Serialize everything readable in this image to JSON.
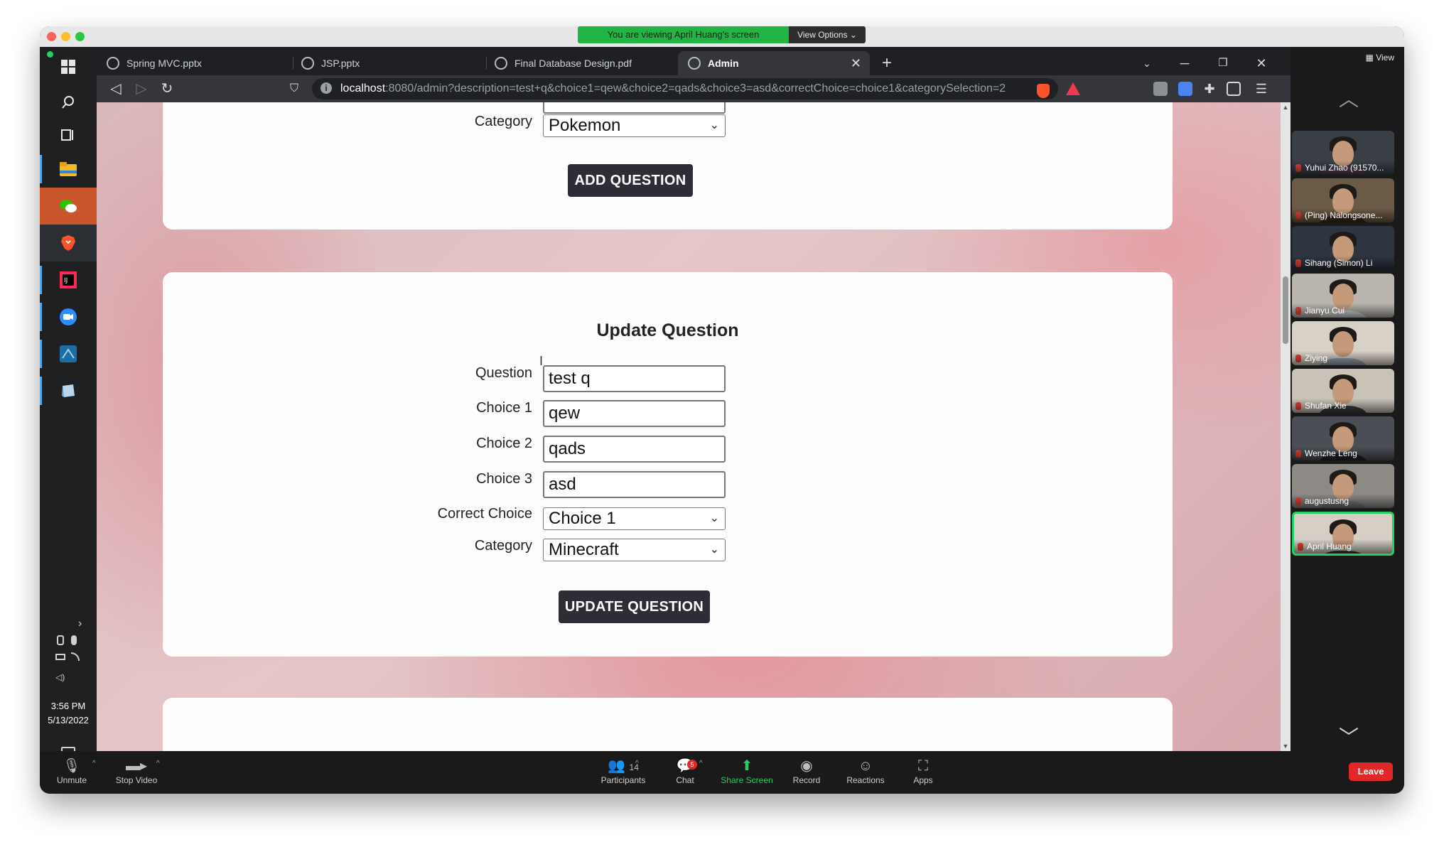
{
  "zoom": {
    "banner_text": "You are viewing April Huang's screen",
    "view_options": "View Options ⌄",
    "panel_view": "View",
    "controls": {
      "unmute": "Unmute",
      "stop_video": "Stop Video",
      "participants": "Participants",
      "participants_count": "14",
      "chat": "Chat",
      "chat_badge": "5",
      "share_screen": "Share Screen",
      "record": "Record",
      "reactions": "Reactions",
      "apps": "Apps",
      "leave": "Leave"
    },
    "participants": [
      {
        "name": "Yuhui Zhao (91570...",
        "shirt": "#5a3d52"
      },
      {
        "name": "(Ping) Nalongsone...",
        "shirt": "#3a2a1e"
      },
      {
        "name": "Sihang (Simon) Li",
        "shirt": "#2b2b2b"
      },
      {
        "name": "Jianyu Cui",
        "shirt": "#d9d9d9"
      },
      {
        "name": "Ziying",
        "shirt": "#9aa3ad"
      },
      {
        "name": "Shufan Xie",
        "shirt": "#3c3c3c"
      },
      {
        "name": "Wenzhe Leng",
        "shirt": "#20232a"
      },
      {
        "name": "augustusng",
        "shirt": "#7a7a7a"
      },
      {
        "name": "April Huang",
        "shirt": "#3a3a3a"
      }
    ]
  },
  "taskbar": {
    "time": "3:56 PM",
    "date": "5/13/2022"
  },
  "browser": {
    "tabs": [
      {
        "label": "Spring MVC.pptx"
      },
      {
        "label": "JSP.pptx"
      },
      {
        "label": "Final Database Design.pdf"
      },
      {
        "label": "Admin"
      }
    ],
    "url_host": "localhost",
    "url_rest": ":8080/admin?description=test+q&choice1=qew&choice2=qads&choice3=asd&correctChoice=choice1&categorySelection=2"
  },
  "page": {
    "add_form": {
      "category_label": "Category",
      "category_value": "Pokemon",
      "add_button": "ADD QUESTION"
    },
    "update_form": {
      "title": "Update Question",
      "question_label": "Question",
      "question_value": "test q",
      "choice1_label": "Choice 1",
      "choice1_value": "qew",
      "choice2_label": "Choice 2",
      "choice2_value": "qads",
      "choice3_label": "Choice 3",
      "choice3_value": "asd",
      "correct_label": "Correct Choice",
      "correct_value": "Choice 1",
      "category_label": "Category",
      "category_value": "Minecraft",
      "update_button": "UPDATE QUESTION"
    }
  }
}
